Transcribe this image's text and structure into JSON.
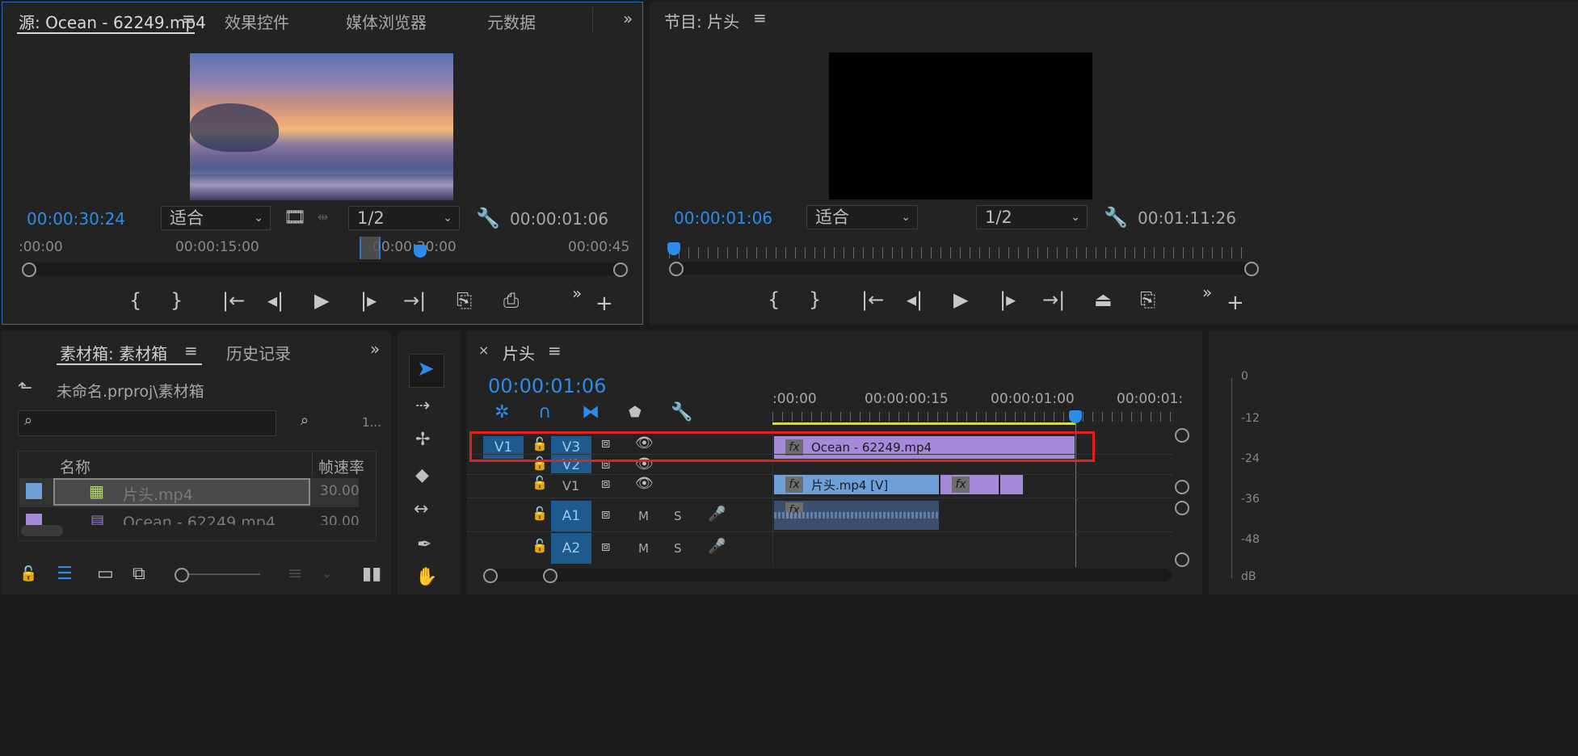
{
  "source_panel": {
    "tabs": [
      "源: Ocean - 62249.mp4",
      "效果控件",
      "媒体浏览器",
      "元数据"
    ],
    "timecode_current": "00:00:30:24",
    "fit_select": "适合",
    "res_select": "1/2",
    "timecode_duration": "00:00:01:06",
    "ruler_labels": [
      ":00:00",
      "00:00:15:00",
      "00:00:30:00",
      "00:00:45"
    ]
  },
  "program_panel": {
    "title": "节目: 片头",
    "timecode_current": "00:00:01:06",
    "fit_select": "适合",
    "res_select": "1/2",
    "timecode_duration": "00:01:11:26"
  },
  "project_panel": {
    "tabs": [
      "素材箱: 素材箱",
      "历史记录"
    ],
    "path": "未命名.prproj\\素材箱",
    "item_count": "1...",
    "columns": [
      "名称",
      "帧速率"
    ],
    "items": [
      {
        "name": "片头.mp4",
        "fps": "30.00",
        "color": "#6e9fd6"
      },
      {
        "name": "Ocean - 62249.mp4",
        "fps": "30.00",
        "color": "#a58ad9"
      }
    ]
  },
  "timeline_panel": {
    "title": "片头",
    "timecode": "00:00:01:06",
    "ruler_labels": [
      ":00:00",
      "00:00:00:15",
      "00:00:01:00",
      "00:00:01:"
    ],
    "tracks": {
      "v3": {
        "src": "V1",
        "label": "V3"
      },
      "v2": {
        "label": "V2"
      },
      "v1": {
        "label": "V1"
      },
      "a1": {
        "label": "A1",
        "m": "M",
        "s": "S"
      },
      "a2": {
        "label": "A2",
        "m": "M",
        "s": "S"
      }
    },
    "clips": {
      "v3_clip": "Ocean - 62249.mp4",
      "v1_clip": "片头.mp4 [V]"
    },
    "fx_label": "fx"
  },
  "audio_meter": {
    "labels": [
      "0",
      "-12",
      "-24",
      "-36",
      "-48",
      "dB"
    ]
  },
  "colors": {
    "accent_blue": "#2d8ceb",
    "clip_purple": "#a58ad9",
    "clip_blue": "#6e9fd6",
    "highlight_red": "#e02020",
    "work_area_yellow": "#e8e000"
  }
}
